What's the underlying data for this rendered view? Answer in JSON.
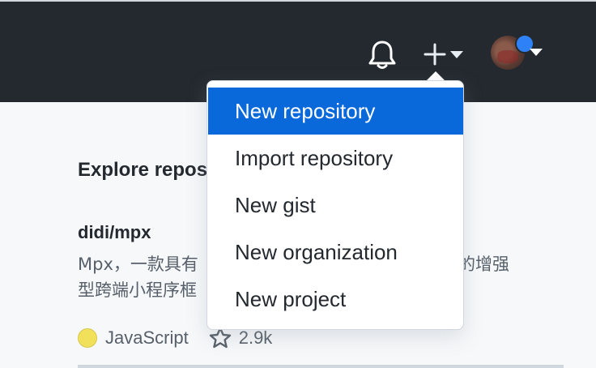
{
  "header": {
    "icons": {
      "notifications": "bell-icon",
      "create": "plus-icon",
      "caret": "triangle-down-icon"
    }
  },
  "create_menu": {
    "items": [
      {
        "label": "New repository",
        "active": true
      },
      {
        "label": "Import repository",
        "active": false
      },
      {
        "label": "New gist",
        "active": false
      },
      {
        "label": "New organization",
        "active": false
      },
      {
        "label": "New project",
        "active": false
      }
    ]
  },
  "explore": {
    "title": "Explore repositories",
    "repo": {
      "name": "didi/mpx",
      "description_line1_left": "Mpx，一款具有",
      "description_line1_right": "的增强",
      "description_line2": "型跨端小程序框",
      "language": "JavaScript",
      "stars": "2.9k"
    }
  },
  "colors": {
    "header_bg": "#24292f",
    "menu_active": "#0969da",
    "javascript": "#f1e05a",
    "notification_dot": "#2f81f7"
  }
}
